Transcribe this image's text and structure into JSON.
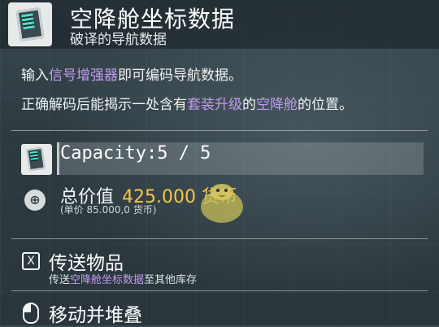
{
  "header": {
    "title": "空降舱坐标数据",
    "subtitle": "破译的导航数据",
    "icon": "navigation-data-device-icon"
  },
  "description": {
    "line1": [
      {
        "text": "输入",
        "highlight": false
      },
      {
        "text": "信号增强器",
        "highlight": true
      },
      {
        "text": "即可编码导航数据。",
        "highlight": false
      }
    ],
    "line2": [
      {
        "text": "正确解码后能揭示一处含有",
        "highlight": false
      },
      {
        "text": "套装升级",
        "highlight": true
      },
      {
        "text": "的",
        "highlight": false
      },
      {
        "text": "空降舱",
        "highlight": true
      },
      {
        "text": "的位置。",
        "highlight": false
      }
    ]
  },
  "capacity": {
    "text": "Capacity:5 / 5",
    "fraction": 1.0
  },
  "value": {
    "label": "总价值",
    "amount": "425.000 货币",
    "unit_price": "(单价 85.000,0 货币)",
    "currency_icon": "units-currency-icon"
  },
  "actions": {
    "transfer": {
      "key": "X",
      "title": "传送物品",
      "sub_pre": "传送",
      "sub_highlight": "空降舱坐标数据",
      "sub_post": "至其他库存"
    },
    "move_stack": {
      "title": "移动并堆叠",
      "icon": "mouse-click-icon"
    }
  },
  "colors": {
    "highlight": "#c29cf2",
    "amount": "#f5c842"
  }
}
